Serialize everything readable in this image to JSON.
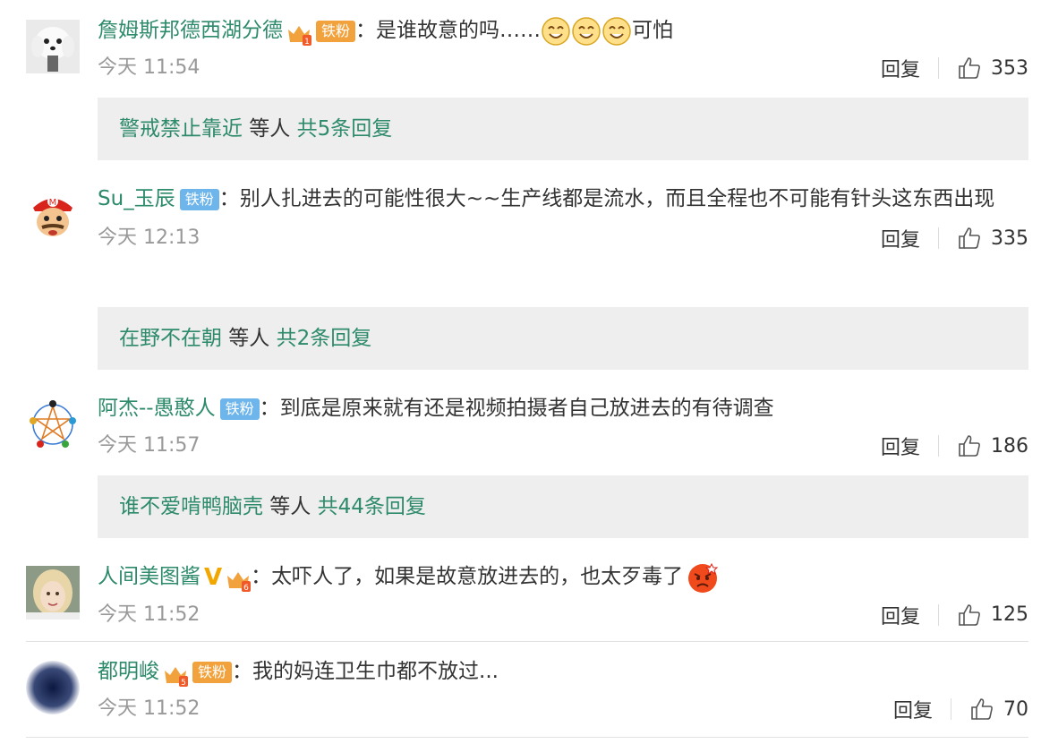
{
  "comments": [
    {
      "username": "詹姆斯邦德西湖分德",
      "badge": "铁粉",
      "text_before": "：是谁故意的吗……",
      "text_after": "可怕",
      "time": "今天 11:54",
      "reply_label": "回复",
      "likes": "353",
      "icon": "dog-avatar",
      "replies": {
        "name": "警戒禁止靠近",
        "mid": " 等人 ",
        "count": "共5条回复"
      }
    },
    {
      "username": "Su_玉辰",
      "badge": "铁粉",
      "text": "：别人扎进去的可能性很大~~生产线都是流水，而且全程也不可能有针头这东西出现",
      "time": "今天 12:13",
      "reply_label": "回复",
      "likes": "335",
      "icon": "mario-avatar",
      "replies": {
        "name": "在野不在朝",
        "mid": " 等人 ",
        "count": "共2条回复"
      }
    },
    {
      "username": "阿杰--愚憨人",
      "badge": "铁粉",
      "text": "：到底是原来就有还是视频拍摄者自己放进去的有待调查",
      "time": "今天 11:57",
      "reply_label": "回复",
      "likes": "186",
      "icon": "pentagram-avatar",
      "replies": {
        "name": "谁不爱啃鸭脑壳",
        "mid": " 等人 ",
        "count": "共44条回复"
      }
    },
    {
      "username": "人间美图酱",
      "text": "：太吓人了，如果是故意放进去的，也太歹毒了",
      "time": "今天 11:52",
      "reply_label": "回复",
      "likes": "125",
      "icon": "girl-avatar"
    },
    {
      "username": "都明峻",
      "badge": "铁粉",
      "text": "：我的妈连卫生巾都不放过...",
      "time": "今天 11:52",
      "reply_label": "回复",
      "likes": "70",
      "icon": "dark-circle-avatar"
    }
  ],
  "colors": {
    "link": "#2d8a6a",
    "meta": "#999999",
    "reply_bg": "#eeeeee",
    "fan_badge_gold": "#f2a23c",
    "fan_badge_blue": "#6eb5ec"
  }
}
